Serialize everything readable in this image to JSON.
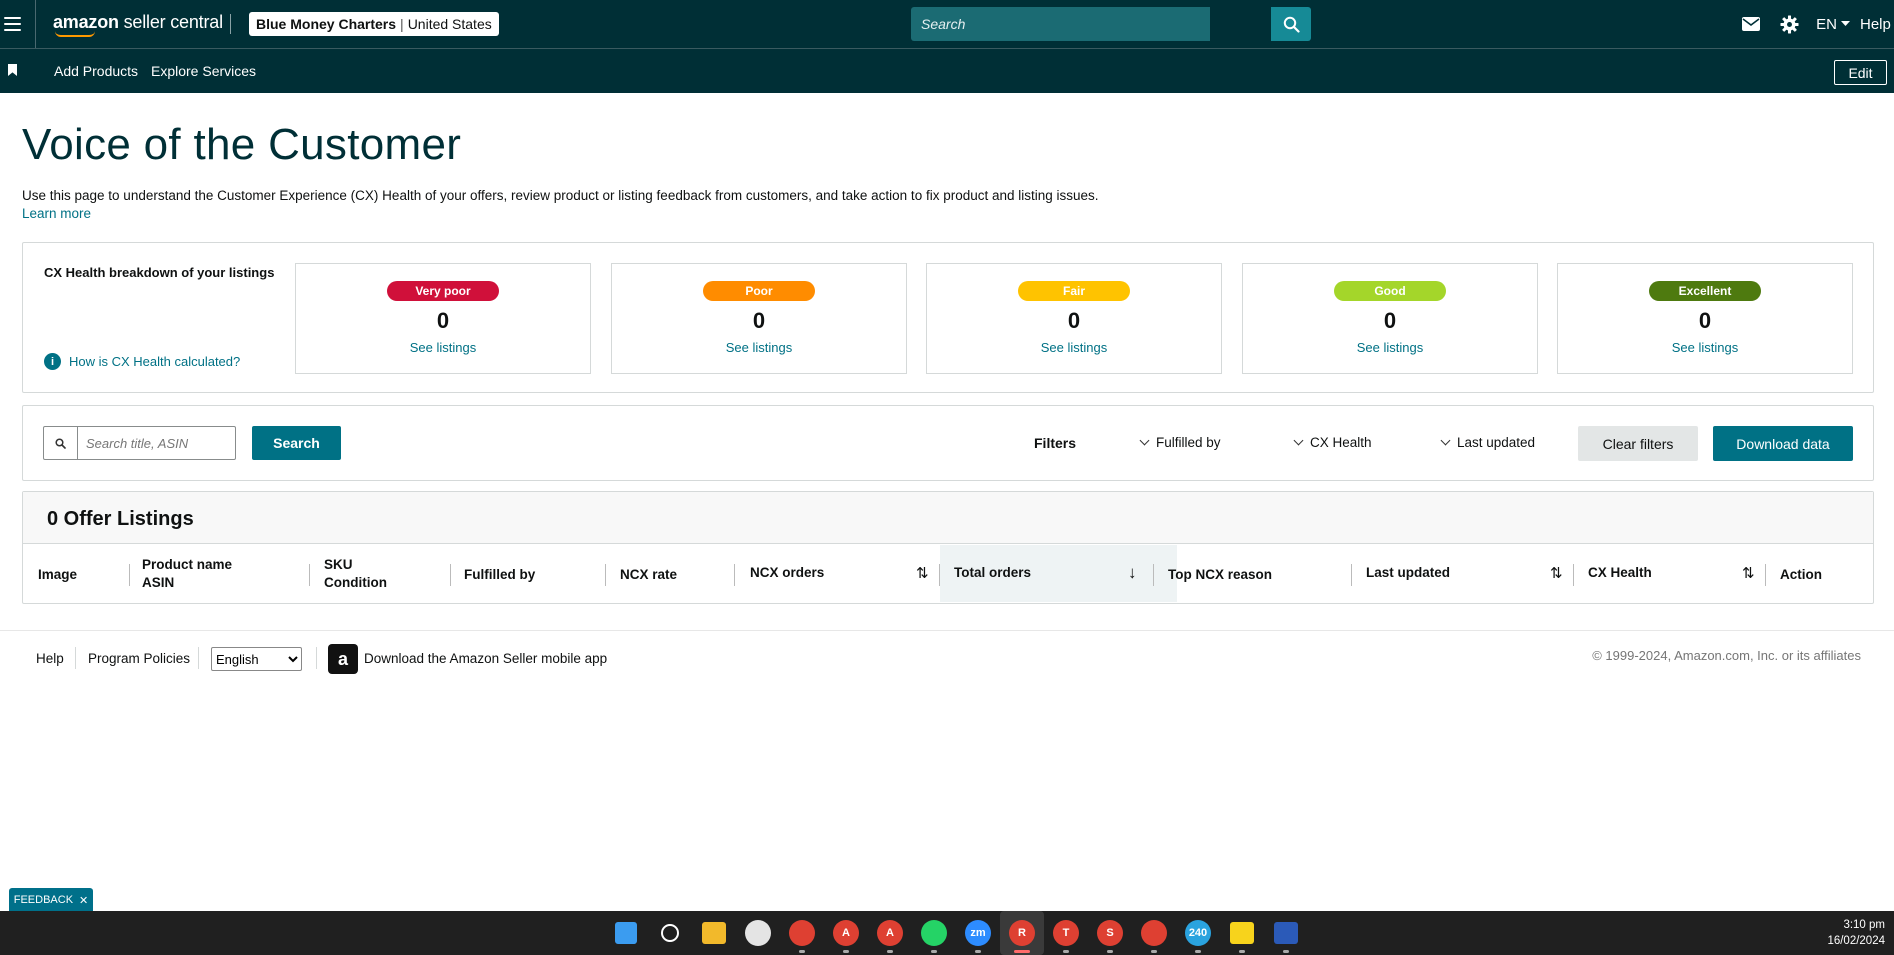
{
  "topnav": {
    "logo_text_light": "amazon",
    "logo_text_rest": " seller central",
    "account_name": "Blue Money Charters",
    "account_region": "United States",
    "search_placeholder": "Search",
    "language": "EN",
    "help": "Help"
  },
  "subnav": {
    "links": [
      "Add Products",
      "Explore Services"
    ],
    "edit_label": "Edit"
  },
  "page": {
    "title": "Voice of the Customer",
    "description": "Use this page to understand the Customer Experience (CX) Health of your offers, review product or listing feedback from customers, and take action to fix product and listing issues.",
    "learn_more": "Learn more"
  },
  "health": {
    "heading": "CX Health breakdown of your listings",
    "how_link": "How is CX Health calculated?",
    "cards": [
      {
        "label": "Very poor",
        "count": "0",
        "link": "See listings",
        "color": "#d0103a"
      },
      {
        "label": "Poor",
        "count": "0",
        "link": "See listings",
        "color": "#ff8c00"
      },
      {
        "label": "Fair",
        "count": "0",
        "link": "See listings",
        "color": "#ffc300"
      },
      {
        "label": "Good",
        "count": "0",
        "link": "See listings",
        "color": "#a4d62a"
      },
      {
        "label": "Excellent",
        "count": "0",
        "link": "See listings",
        "color": "#4e7a0f"
      }
    ]
  },
  "filters": {
    "search_placeholder": "Search title, ASIN",
    "search_button": "Search",
    "label": "Filters",
    "dropdowns": [
      "Fulfilled by",
      "CX Health",
      "Last updated"
    ],
    "clear_button": "Clear filters",
    "download_button": "Download data"
  },
  "listings": {
    "title": "0 Offer Listings",
    "columns": {
      "image": "Image",
      "product_name": "Product name",
      "asin": "ASIN",
      "sku": "SKU",
      "condition": "Condition",
      "fulfilled_by": "Fulfilled by",
      "ncx_rate": "NCX rate",
      "ncx_orders": "NCX orders",
      "total_orders": "Total orders",
      "top_ncx_reason": "Top NCX reason",
      "last_updated": "Last updated",
      "cx_health": "CX Health",
      "action": "Action"
    }
  },
  "footer": {
    "help": "Help",
    "policies": "Program Policies",
    "language_selected": "English",
    "app_text": "Download the Amazon Seller mobile app",
    "copyright": "© 1999-2024, Amazon.com, Inc. or its affiliates"
  },
  "feedback": {
    "label": "FEEDBACK",
    "close": "✕"
  },
  "taskbar": {
    "time": "3:10 pm",
    "date": "16/02/2024",
    "icons": [
      {
        "name": "start-icon",
        "color": "#3b9cf0",
        "badge": ""
      },
      {
        "name": "search-icon",
        "color": "#202020",
        "badge": ""
      },
      {
        "name": "file-explorer-icon",
        "color": "#f2b92b",
        "badge": ""
      },
      {
        "name": "slack-icon",
        "color": "#e4e4e4",
        "badge": ""
      },
      {
        "name": "chrome-icon",
        "color": "#de4032",
        "badge": ""
      },
      {
        "name": "chrome-profile-a-icon",
        "color": "#de4032",
        "badge": "A"
      },
      {
        "name": "chrome-profile-a2-icon",
        "color": "#de4032",
        "badge": "A"
      },
      {
        "name": "whatsapp-icon",
        "color": "#25d366",
        "badge": ""
      },
      {
        "name": "zoom-icon",
        "color": "#2d8cff",
        "badge": "zm"
      },
      {
        "name": "chrome-profile-r-icon",
        "color": "#de4032",
        "badge": "R"
      },
      {
        "name": "chrome-profile-t-icon",
        "color": "#de4032",
        "badge": "T"
      },
      {
        "name": "chrome-profile-s-icon",
        "color": "#de4032",
        "badge": "S"
      },
      {
        "name": "chrome-default-icon",
        "color": "#de4032",
        "badge": ""
      },
      {
        "name": "telegram-icon",
        "color": "#2aa3df",
        "badge": "240"
      },
      {
        "name": "sticky-notes-icon",
        "color": "#f7d31c",
        "badge": ""
      },
      {
        "name": "word-icon",
        "color": "#2b5ab8",
        "badge": ""
      }
    ]
  }
}
